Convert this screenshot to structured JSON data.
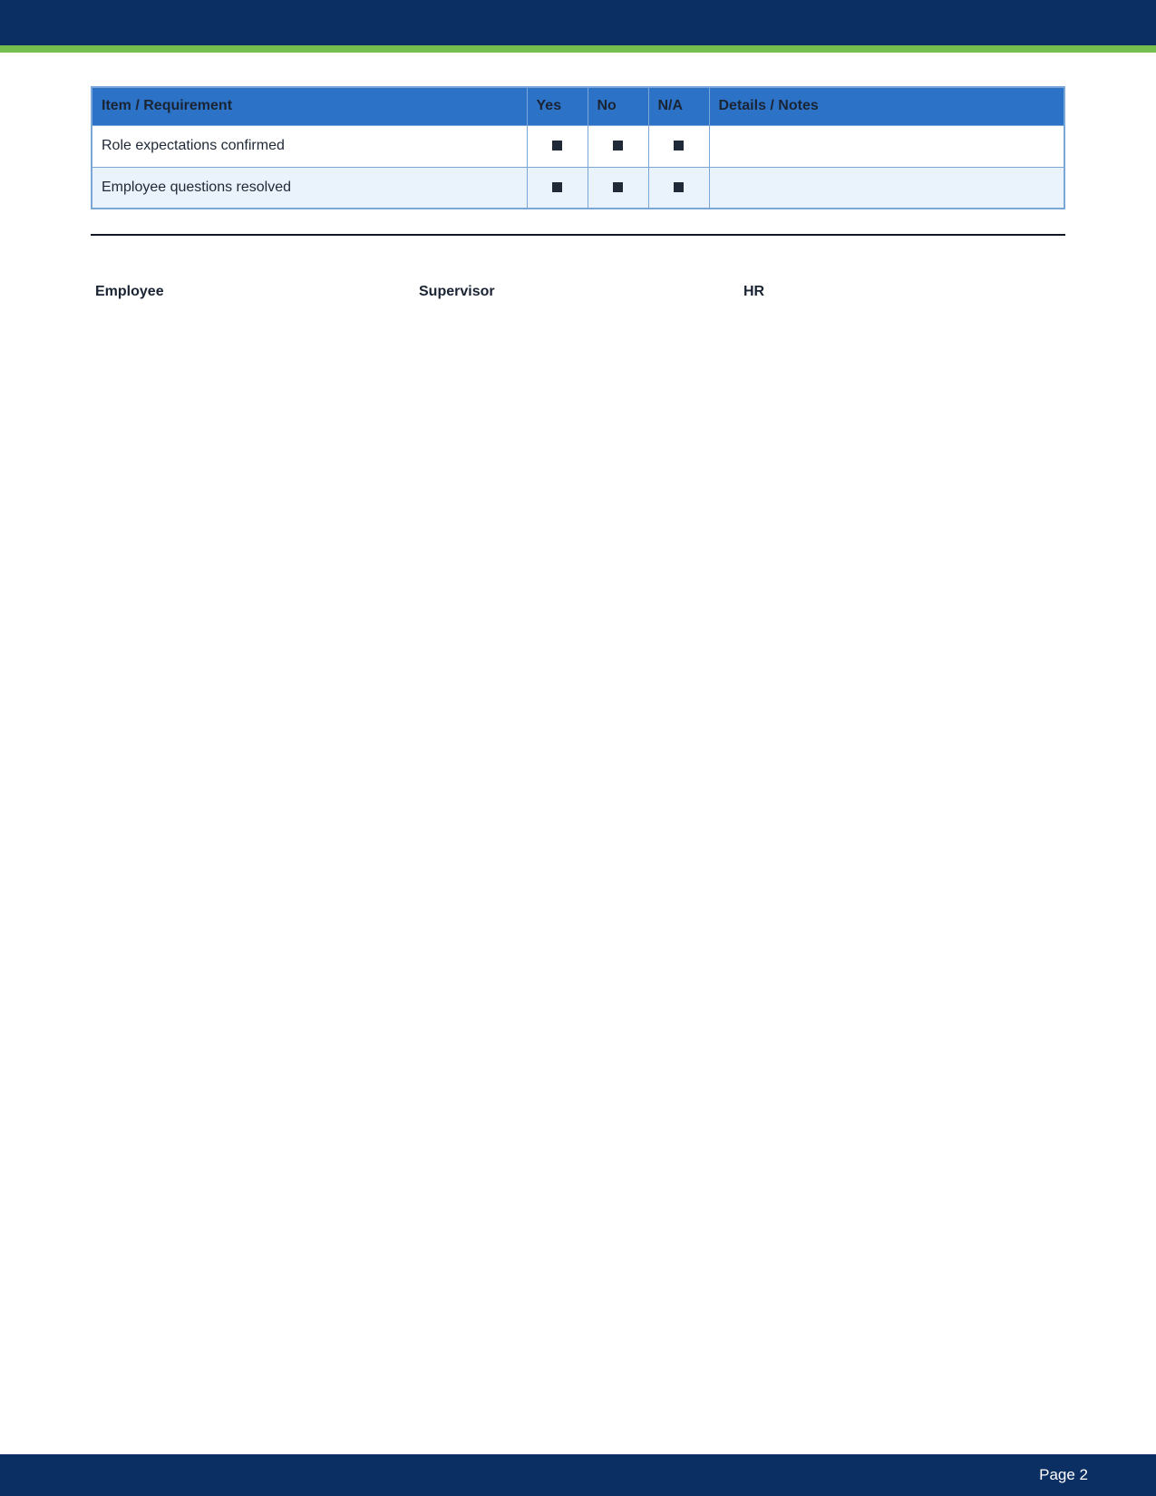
{
  "colors": {
    "header_navy": "#0b2e63",
    "header_accent_green": "#76bf4f",
    "table_header_blue": "#2c73c8",
    "table_border": "#7aa6d8",
    "row_alt_background": "#eaf2fb"
  },
  "checklist": {
    "headers": {
      "item": "Item / Requirement",
      "yes": "Yes",
      "no": "No",
      "na": "N/A",
      "notes": "Details / Notes"
    },
    "rows": [
      {
        "item": "Role expectations confirmed",
        "yes": "■",
        "no": "■",
        "na": "■",
        "notes": ""
      },
      {
        "item": "Employee questions resolved",
        "yes": "■",
        "no": "■",
        "na": "■",
        "notes": ""
      }
    ]
  },
  "signatures": {
    "employee_label": "Employee",
    "supervisor_label": "Supervisor",
    "hr_label": "HR"
  },
  "footer": {
    "page_label": "Page 2"
  }
}
